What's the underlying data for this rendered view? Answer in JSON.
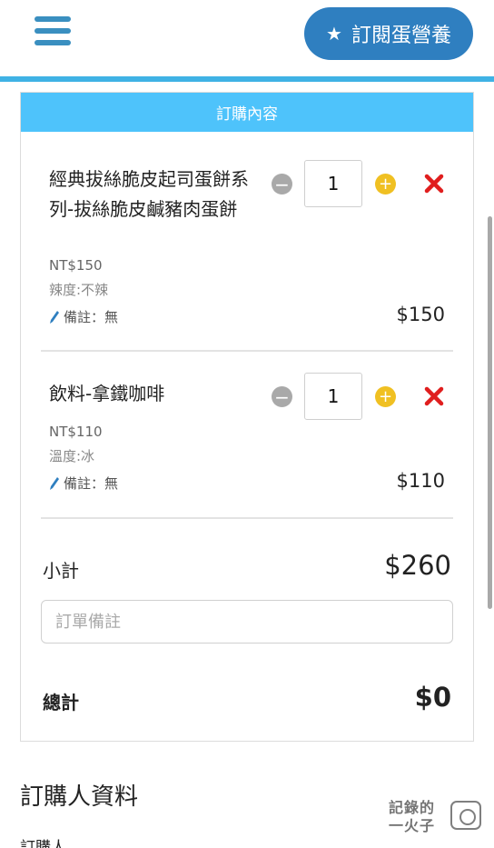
{
  "header": {
    "subscribe_label": "訂閱蛋營養",
    "accent": "#2f7fc0",
    "bar_color": "#3fb2e5"
  },
  "order": {
    "section_header": "訂購內容",
    "header_color": "#4ec3fb",
    "items": [
      {
        "name": "經典拔絲脆皮起司蛋餅系列-拔絲脆皮鹹豬肉蛋餅",
        "unit_price": "NT$150",
        "option": "辣度:不辣",
        "note": "備註：無",
        "quantity": "1",
        "line_total": "$150"
      },
      {
        "name": "飲料-拿鐵咖啡",
        "unit_price": "NT$110",
        "option": "溫度:冰",
        "note": "備註：無",
        "quantity": "1",
        "line_total": "$110"
      }
    ],
    "subtotal_label": "小計",
    "subtotal_value": "$260",
    "note_placeholder": "訂單備註",
    "note_value": "",
    "total_label": "總計",
    "total_value": "$0"
  },
  "orderer": {
    "section_title": "訂購人資料",
    "name_label": "訂購人"
  },
  "watermark": {
    "text": "記錄的一火子"
  },
  "icons": {
    "menu": "hamburger-icon",
    "star": "star-icon",
    "minus": "minus-circle-icon",
    "plus": "plus-circle-icon",
    "delete": "close-x-icon",
    "pencil": "pencil-icon"
  },
  "colors": {
    "minus": "#a9a9a9",
    "plus": "#f0c022",
    "delete": "#e01e1e"
  }
}
